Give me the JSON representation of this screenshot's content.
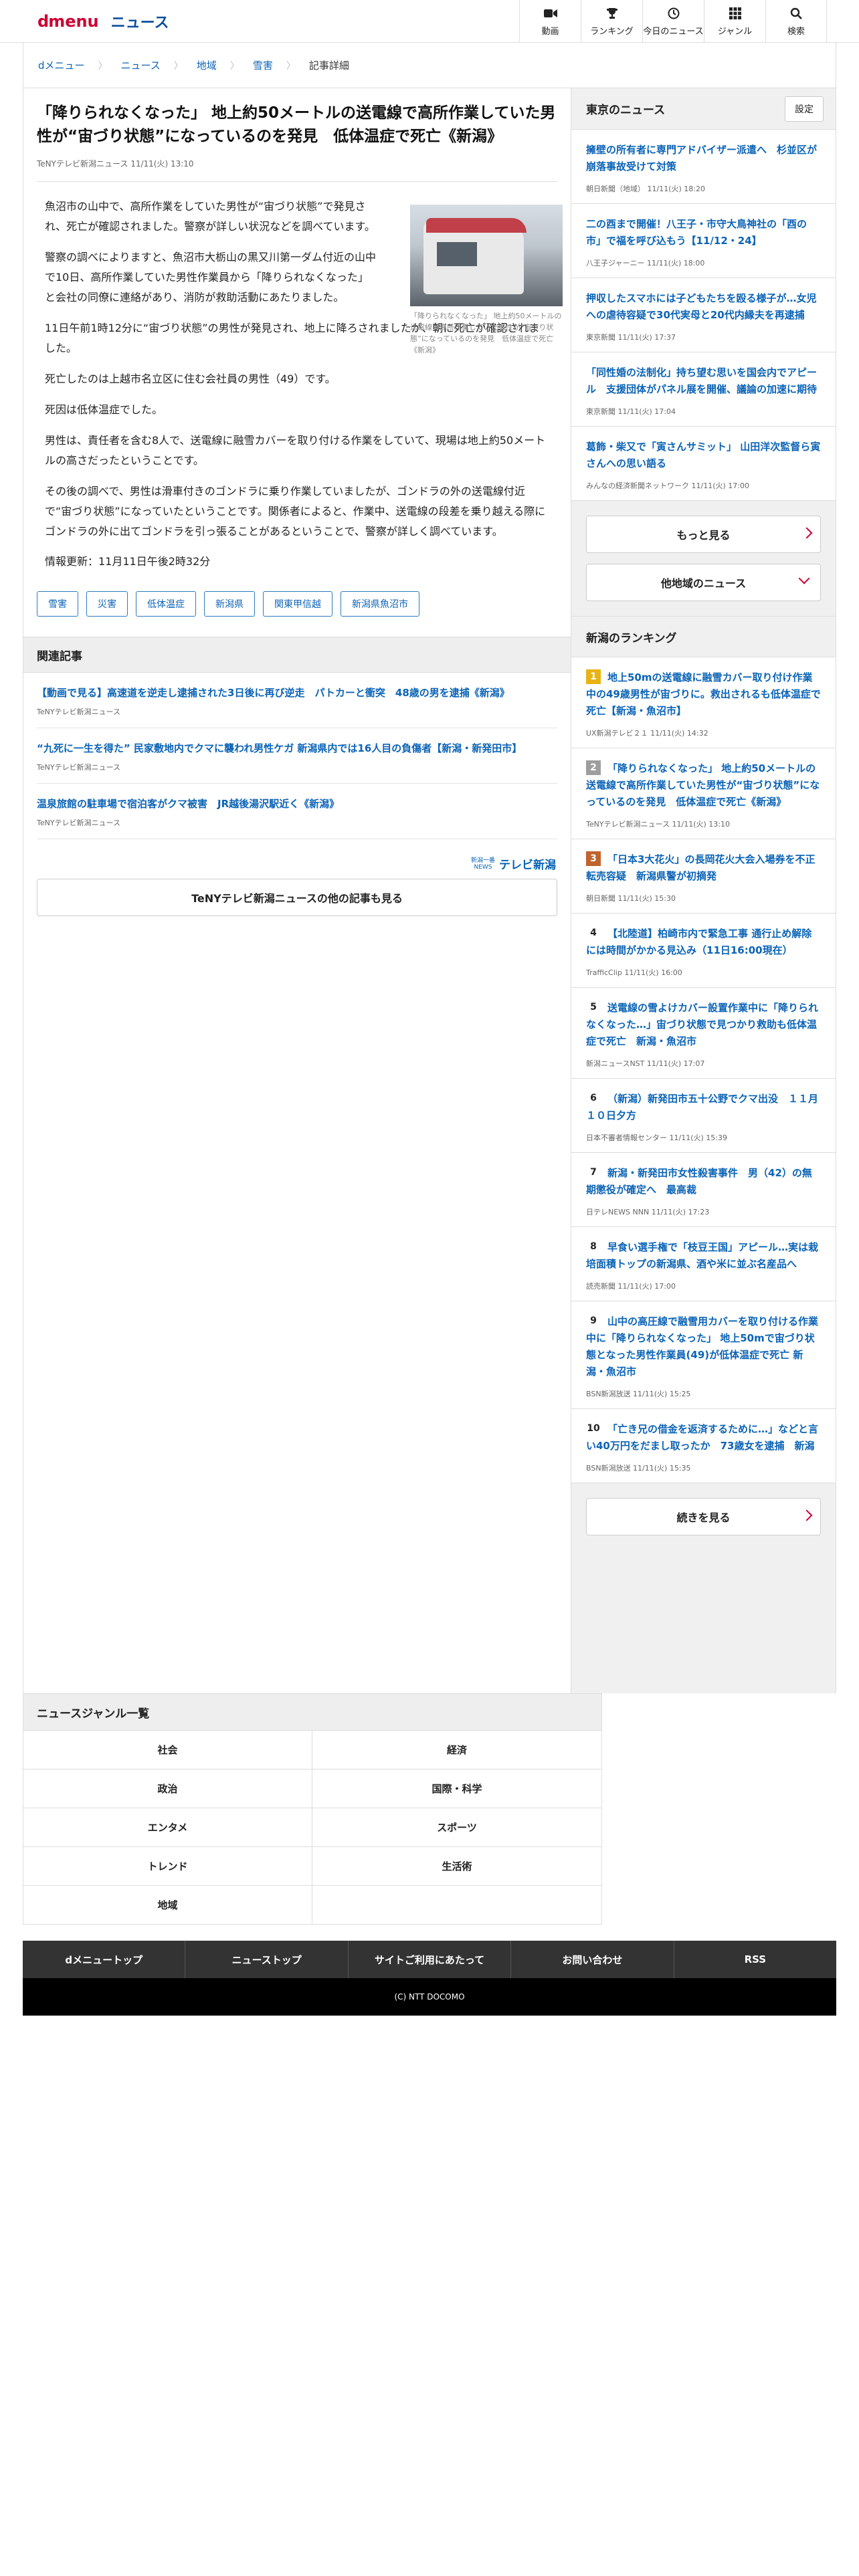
{
  "header": {
    "logo_d": "d",
    "logo_menu": "menu",
    "logo_news": "ニュース",
    "nav": [
      {
        "label": "動画",
        "icon": "video-icon"
      },
      {
        "label": "ランキング",
        "icon": "trophy-icon"
      },
      {
        "label": "今日のニュース",
        "icon": "clock-icon"
      },
      {
        "label": "ジャンル",
        "icon": "grid-icon"
      },
      {
        "label": "検索",
        "icon": "search-icon"
      }
    ]
  },
  "breadcrumb": [
    "dメニュー",
    "ニュース",
    "地域",
    "雪害",
    "記事詳細"
  ],
  "article": {
    "title": "「降りられなくなった」 地上約50メートルの送電線で高所作業していた男性が“宙づり状態”になっているのを発見　低体温症で死亡《新潟》",
    "meta": "TeNYテレビ新潟ニュース 11/11(火) 13:10",
    "figure_caption": "「降りられなくなった」 地上約50メートルの送電線で高所作業していた男性が“宙づり状態”になっているのを発見　低体温症で死亡《新潟》",
    "paragraphs": [
      "魚沼市の山中で、高所作業をしていた男性が“宙づり状態”で発見され、死亡が確認されました。警察が詳しい状況などを調べています。",
      "警察の調べによりますと、魚沼市大栃山の黒又川第一ダム付近の山中で10日、高所作業していた男性作業員から「降りられなくなった」と会社の同僚に連絡があり、消防が救助活動にあたりました。",
      "11日午前1時12分に“宙づり状態”の男性が発見され、地上に降ろされましたが、朝に死亡が確認されました。",
      "死亡したのは上越市名立区に住む会社員の男性（49）です。",
      "死因は低体温症でした。",
      "男性は、責任者を含む8人で、送電線に融雪カバーを取り付ける作業をしていて、現場は地上約50メートルの高さだったということです。",
      "その後の調べで、男性は滑車付きのゴンドラに乗り作業していましたが、ゴンドラの外の送電線付近で“宙づり状態”になっていたということです。関係者によると、作業中、送電線の段差を乗り越える際にゴンドラの外に出てゴンドラを引っ張ることがあるということで、警察が詳しく調べています。"
    ],
    "updated": "情報更新：11月11日午後2時32分",
    "tags": [
      "雪害",
      "災害",
      "低体温症",
      "新潟県",
      "関東甲信越",
      "新潟県魚沼市"
    ]
  },
  "related": {
    "heading": "関連記事",
    "items": [
      {
        "title": "【動画で見る】高速道を逆走し逮捕された3日後に再び逆走　パトカーと衝突　48歳の男を逮捕《新潟》",
        "meta": "TeNYテレビ新潟ニュース"
      },
      {
        "title": "“九死に一生を得た” 民家敷地内でクマに襲われ男性ケガ 新潟県内では16人目の負傷者【新潟・新発田市】",
        "meta": "TeNYテレビ新潟ニュース"
      },
      {
        "title": "温泉旅館の駐車場で宿泊客がクマ被害　JR越後湯沢駅近く《新潟》",
        "meta": "TeNYテレビ新潟ニュース"
      }
    ],
    "source_logo_small": "新潟一番\nNEWS",
    "source_logo": "テレビ新潟",
    "more_label": "TeNYテレビ新潟ニュースの他の記事も見る"
  },
  "sidebar": {
    "tokyo_heading": "東京のニュース",
    "settings_label": "設定",
    "tokyo_items": [
      {
        "title": "擁壁の所有者に専門アドバイザー派遣へ　杉並区が崩落事故受けて対策",
        "meta": "朝日新聞（地域） 11/11(火) 18:20"
      },
      {
        "title": "二の酉まで開催！八王子・市守大鳥神社の「酉の市」で福を呼び込もう【11/12・24】",
        "meta": "八王子ジャーニー 11/11(火) 18:00"
      },
      {
        "title": "押収したスマホには子どもたちを殴る様子が…女児への虐待容疑で30代実母と20代内縁夫を再逮捕",
        "meta": "東京新聞 11/11(火) 17:37"
      },
      {
        "title": "「同性婚の法制化」持ち望む思いを国会内でアピール　支援団体がパネル展を開催、議論の加速に期待",
        "meta": "東京新聞 11/11(火) 17:04"
      },
      {
        "title": "葛飾・柴又で「寅さんサミット」 山田洋次監督ら寅さんへの思い語る",
        "meta": "みんなの経済新聞ネットワーク 11/11(火) 17:00"
      }
    ],
    "more_label": "もっと見る",
    "other_region_label": "他地域のニュース",
    "ranking_heading": "新潟のランキング",
    "ranking": [
      {
        "rank": "1",
        "title": "地上50mの送電線に融雪カバー取り付け作業中の49歳男性が宙づりに。救出されるも低体温症で死亡【新潟・魚沼市】",
        "meta": "UX新潟テレビ２１ 11/11(火) 14:32"
      },
      {
        "rank": "2",
        "title": "「降りられなくなった」 地上約50メートルの送電線で高所作業していた男性が“宙づり状態”になっているのを発見　低体温症で死亡《新潟》",
        "meta": "TeNYテレビ新潟ニュース 11/11(火) 13:10"
      },
      {
        "rank": "3",
        "title": "「日本3大花火」の長岡花火大会入場券を不正転売容疑　新潟県警が初摘発",
        "meta": "朝日新聞 11/11(火) 15:30"
      },
      {
        "rank": "4",
        "title": "【北陸道】柏崎市内で緊急工事 通行止め解除には時間がかかる見込み（11日16:00現在）",
        "meta": "TrafficClip 11/11(火) 16:00"
      },
      {
        "rank": "5",
        "title": "送電線の雪よけカバー設置作業中に「降りられなくなった…」宙づり状態で見つかり救助も低体温症で死亡　新潟・魚沼市",
        "meta": "新潟ニュースNST 11/11(火) 17:07"
      },
      {
        "rank": "6",
        "title": "（新潟）新発田市五十公野でクマ出没　１１月１０日夕方",
        "meta": "日本不審者情報センター 11/11(火) 15:39"
      },
      {
        "rank": "7",
        "title": "新潟・新発田市女性殺害事件　男（42）の無期懲役が確定へ　最高裁",
        "meta": "日テレNEWS NNN 11/11(火) 17:23"
      },
      {
        "rank": "8",
        "title": "早食い選手権で「枝豆王国」アピール…実は栽培面積トップの新潟県、酒や米に並ぶ名産品へ",
        "meta": "読売新聞 11/11(火) 17:00"
      },
      {
        "rank": "9",
        "title": "山中の高圧線で融雪用カバーを取り付ける作業中に「降りられなくなった」 地上50mで宙づり状態となった男性作業員(49)が低体温症で死亡 新潟・魚沼市",
        "meta": "BSN新潟放送 11/11(火) 15:25"
      },
      {
        "rank": "10",
        "title": "「亡き兄の借金を返済するために…」などと言い40万円をだまし取ったか　73歳女を逮捕　新潟",
        "meta": "BSN新潟放送 11/11(火) 15:35"
      }
    ],
    "continue_label": "続きを見る"
  },
  "genres": {
    "heading": "ニュースジャンル一覧",
    "items": [
      "社会",
      "経済",
      "政治",
      "国際・科学",
      "エンタメ",
      "スポーツ",
      "トレンド",
      "生活術",
      "地域",
      ""
    ]
  },
  "footer": {
    "links": [
      "dメニュートップ",
      "ニューストップ",
      "サイトご利用にあたって",
      "お問い合わせ",
      "RSS"
    ],
    "copyright": "(C) NTT DOCOMO"
  },
  "colors": {
    "brand_red": "#cc0033",
    "link_blue": "#0b63b6",
    "news_blue": "#0b4f9c"
  }
}
